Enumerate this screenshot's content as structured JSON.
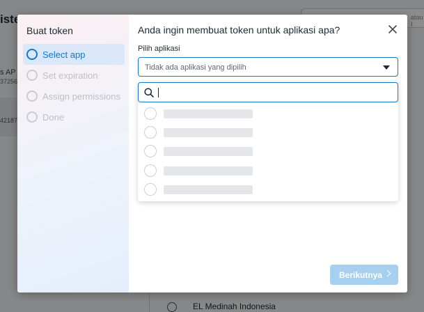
{
  "background": {
    "title": "iste",
    "left_text_1": "s AP",
    "left_text_2": "37256",
    "left_text_3": "42187",
    "search_text": "atau I",
    "bottom_item": "EL Medinah Indonesia"
  },
  "modal": {
    "left_title": "Buat token",
    "steps": [
      {
        "label": "Select app",
        "active": true
      },
      {
        "label": "Set expiration",
        "active": false
      },
      {
        "label": "Assign permissions",
        "active": false
      },
      {
        "label": "Done",
        "active": false
      }
    ],
    "title": "Anda ingin membuat token untuk aplikasi apa?",
    "field_label": "Pilih aplikasi",
    "select_value": "Tidak ada aplikasi yang dipilih",
    "search": {
      "value": "",
      "placeholder": ""
    },
    "options_loading_count": 5,
    "next_label": "Berikutnya"
  },
  "colors": {
    "accent": "#1877c2",
    "next_button_disabled": "#a6cff0"
  }
}
